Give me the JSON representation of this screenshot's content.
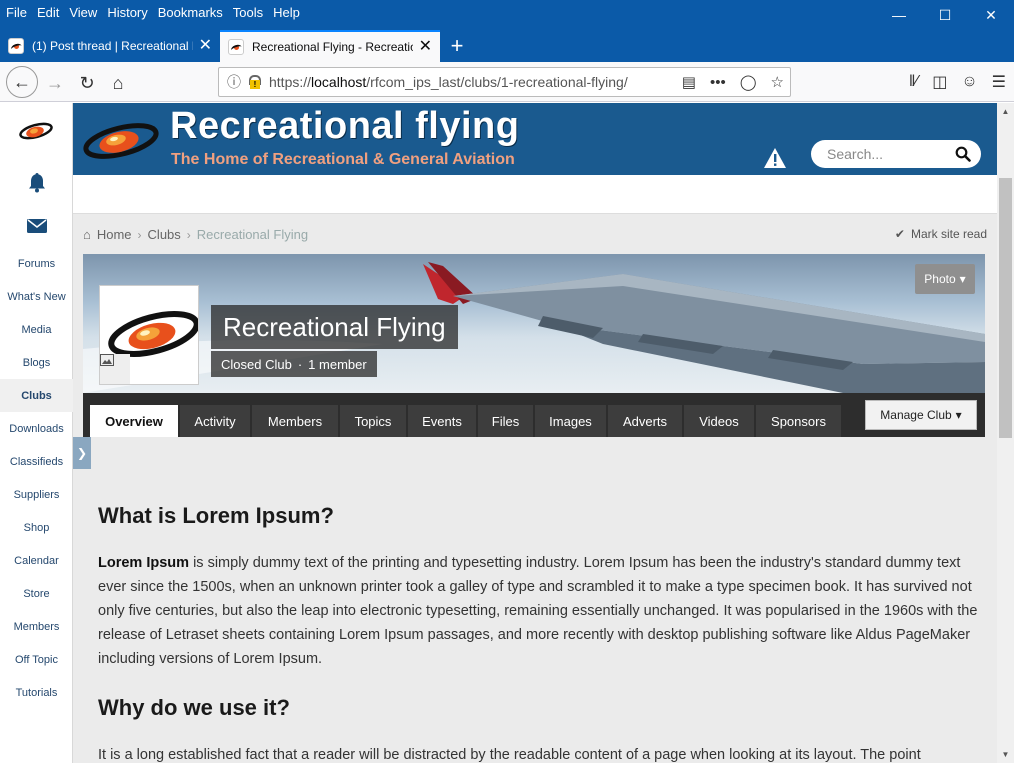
{
  "browser": {
    "menu": [
      "File",
      "Edit",
      "View",
      "History",
      "Bookmarks",
      "Tools",
      "Help"
    ],
    "tabs": [
      {
        "title": "(1) Post thread | Recreational Fl"
      },
      {
        "title": "Recreational Flying - Recreation"
      }
    ],
    "url_prefix": "https://",
    "url_host": "localhost",
    "url_path": "/rfcom_ips_last/clubs/1-recreational-flying/"
  },
  "sidebar": {
    "items": [
      "Forums",
      "What's New",
      "Media",
      "Blogs",
      "Clubs",
      "Downloads",
      "Classifieds",
      "Suppliers",
      "Shop",
      "Calendar",
      "Store",
      "Members",
      "Off Topic",
      "Tutorials"
    ],
    "active": "Clubs"
  },
  "header": {
    "title": "Recreational flying",
    "subtitle": "The Home of Recreational & General Aviation",
    "search_placeholder": "Search..."
  },
  "breadcrumb": {
    "home": "Home",
    "clubs": "Clubs",
    "current": "Recreational Flying"
  },
  "mark_read": "Mark site read",
  "club": {
    "photo_button": "Photo",
    "name": "Recreational Flying",
    "type": "Closed Club",
    "separator": "·",
    "members": "1 member",
    "manage_button": "Manage Club"
  },
  "club_tabs": [
    "Overview",
    "Activity",
    "Members",
    "Topics",
    "Events",
    "Files",
    "Images",
    "Adverts",
    "Videos",
    "Sponsors"
  ],
  "content": {
    "h1": "What is Lorem Ipsum?",
    "p1_bold": "Lorem Ipsum",
    "p1_rest": " is simply dummy text of the printing and typesetting industry. Lorem Ipsum has been the industry's standard dummy text ever since the 1500s, when an unknown printer took a galley of type and scrambled it to make a type specimen book. It has survived not only five centuries, but also the leap into electronic typesetting, remaining essentially unchanged. It was popularised in the 1960s with the release of Letraset sheets containing Lorem Ipsum passages, and more recently with desktop publishing software like Aldus PageMaker including versions of Lorem Ipsum.",
    "h2": "Why do we use it?",
    "p2": "It is a long established fact that a reader will be distracted by the readable content of a page when looking at its layout. The point"
  },
  "colors": {
    "titlebar": "#0b5aa8",
    "header": "#1a5a8f",
    "sidebar_link": "#25486e"
  }
}
